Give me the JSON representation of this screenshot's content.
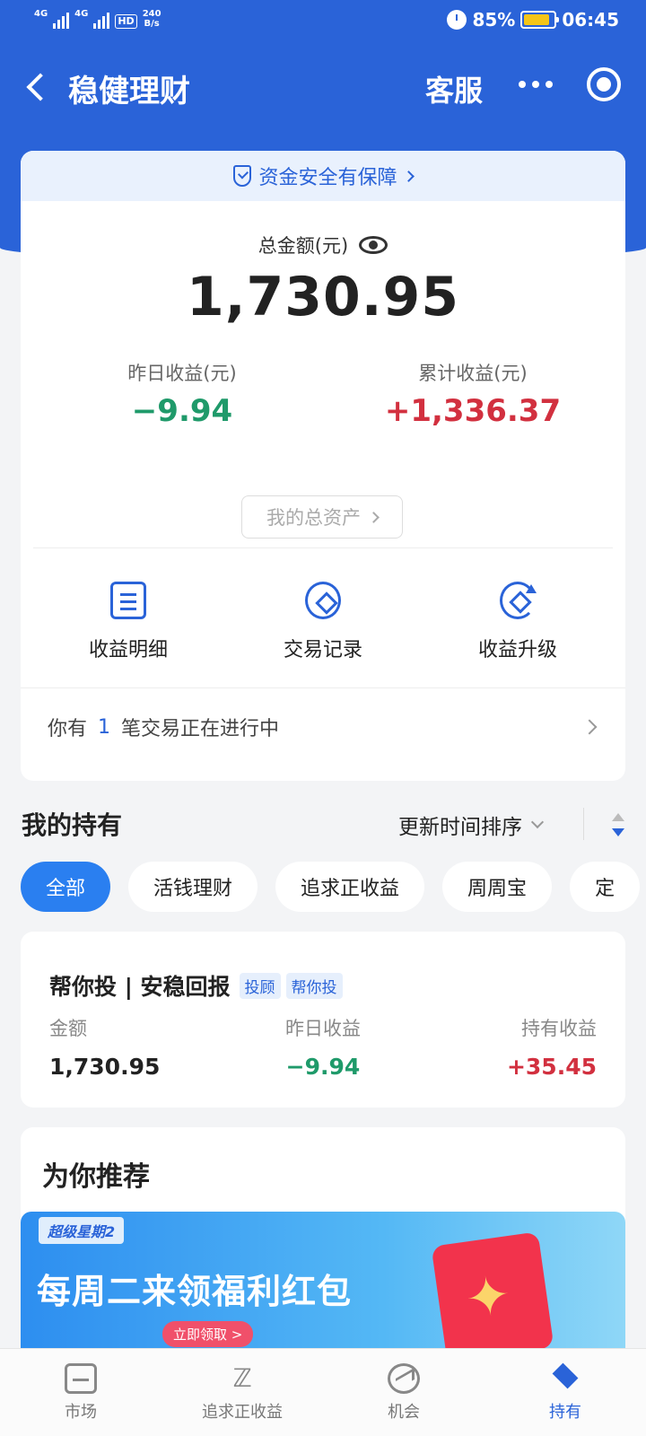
{
  "status_bar": {
    "network1": "4G",
    "network2": "4G",
    "hd": "HD",
    "speed_value": "240",
    "speed_unit": "B/s",
    "battery": "85%",
    "time": "06:45"
  },
  "navbar": {
    "title": "稳健理财",
    "service": "客服"
  },
  "summary": {
    "safety_text": "资金安全有保障",
    "total_label": "总金额(元)",
    "total_value": "1,730.95",
    "yesterday_label": "昨日收益(元)",
    "yesterday_value": "−9.94",
    "cumulative_label": "累计收益(元)",
    "cumulative_value": "+1,336.37",
    "assets_button": "我的总资产",
    "actions": [
      {
        "label": "收益明细",
        "icon": "document-icon"
      },
      {
        "label": "交易记录",
        "icon": "diamond-icon"
      },
      {
        "label": "收益升级",
        "icon": "upgrade-icon"
      }
    ],
    "pending_prefix": "你有",
    "pending_count": "1",
    "pending_suffix": "笔交易正在进行中"
  },
  "holdings": {
    "title": "我的持有",
    "sort_label": "更新时间排序",
    "chips": [
      "全部",
      "活钱理财",
      "追求正收益",
      "周周宝",
      "定"
    ],
    "active_chip": "全部",
    "item": {
      "name": "帮你投 | 安稳回报",
      "tags": [
        "投顾",
        "帮你投"
      ],
      "amount_label": "金额",
      "amount_value": "1,730.95",
      "yesterday_label": "昨日收益",
      "yesterday_value": "−9.94",
      "holding_label": "持有收益",
      "holding_value": "+35.45"
    }
  },
  "recommend": {
    "title": "为你推荐",
    "banner_brand": "超级星期2",
    "banner_headline": "每周二来领福利红包",
    "banner_cta": "立即领取 >"
  },
  "tabbar": {
    "items": [
      {
        "label": "市场",
        "icon": "market-icon"
      },
      {
        "label": "追求正收益",
        "icon": "chase-icon"
      },
      {
        "label": "机会",
        "icon": "opportunity-icon"
      },
      {
        "label": "持有",
        "icon": "holdings-icon"
      }
    ],
    "active": "持有"
  },
  "colors": {
    "brand": "#2a63d8",
    "positive": "#d2303f",
    "negative": "#1f9a6a"
  }
}
